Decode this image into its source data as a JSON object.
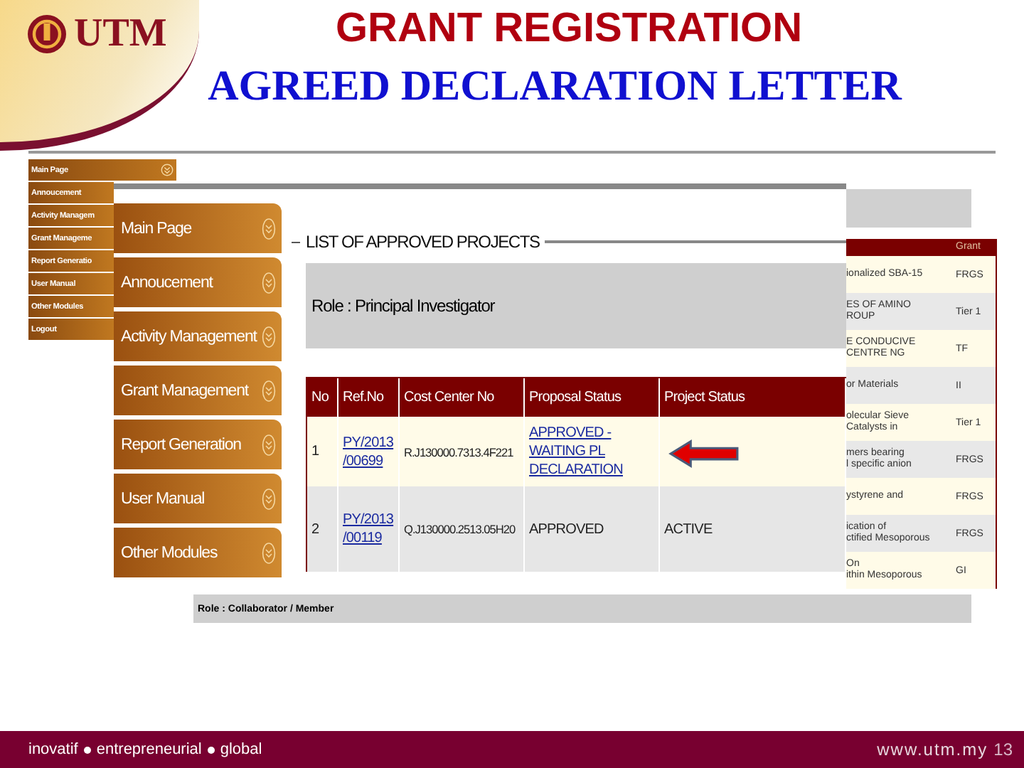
{
  "header": {
    "logo_text": "UTM",
    "title": "GRANT REGISTRATION",
    "subtitle": "AGREED DECLARATION LETTER"
  },
  "back_screen": {
    "menu": [
      {
        "label": "Main Page",
        "kind": "icon"
      },
      {
        "label": "Annoucement",
        "kind": "plain"
      },
      {
        "label": "Activity Managem",
        "kind": "plain"
      },
      {
        "label": "Grant Manageme",
        "kind": "plain"
      },
      {
        "label": "Report Generatio",
        "kind": "plain"
      },
      {
        "label": "User Manual",
        "kind": "plain"
      },
      {
        "label": "Other Modules",
        "kind": "plain"
      },
      {
        "label": "Logout",
        "kind": "plain"
      }
    ],
    "right_table": {
      "header": "Grant",
      "rows": [
        {
          "title": "ionalized SBA-15",
          "grant": "FRGS"
        },
        {
          "title": "ES OF AMINO\nROUP",
          "grant": "Tier 1"
        },
        {
          "title": "E CONDUCIVE\nCENTRE NG",
          "grant": "TF"
        },
        {
          "title": "or Materials",
          "grant": "II"
        },
        {
          "title": "olecular Sieve\nCatalysts in",
          "grant": "Tier 1"
        },
        {
          "title": "mers bearing\nl specific anion",
          "grant": "FRGS"
        },
        {
          "title": "ystyrene and",
          "grant": "FRGS"
        },
        {
          "title": "ication of\nctified Mesoporous",
          "grant": "FRGS"
        },
        {
          "title": "On\nithin Mesoporous",
          "grant": "GI"
        }
      ]
    },
    "role_bar": "Role : Collaborator / Member"
  },
  "front_screen": {
    "menu": [
      "Main Page",
      "Annoucement",
      "Activity Management",
      "Grant Management",
      "Report Generation",
      "User Manual",
      "Other Modules"
    ],
    "section_title": "LIST OF APPROVED PROJECTS",
    "role_bar": "Role : Principal Investigator",
    "table": {
      "columns": [
        "No",
        "Ref.No",
        "Cost Center No",
        "Proposal Status",
        "Project Status"
      ],
      "rows": [
        {
          "no": "1",
          "ref_no": "PY/2013\n/00699",
          "cost_center": "R.J130000.7313.4F221",
          "proposal_status": "APPROVED - WAITING PL DECLARATION",
          "proposal_link": true,
          "project_status": ""
        },
        {
          "no": "2",
          "ref_no": "PY/2013\n/00119",
          "cost_center": "Q.J130000.2513.05H20",
          "proposal_status": "APPROVED",
          "proposal_link": false,
          "project_status": "ACTIVE"
        }
      ]
    }
  },
  "footer": {
    "tagline": [
      "inovatif",
      "entrepreneurial",
      "global"
    ],
    "url": "www.utm.my",
    "page_number": "13"
  }
}
